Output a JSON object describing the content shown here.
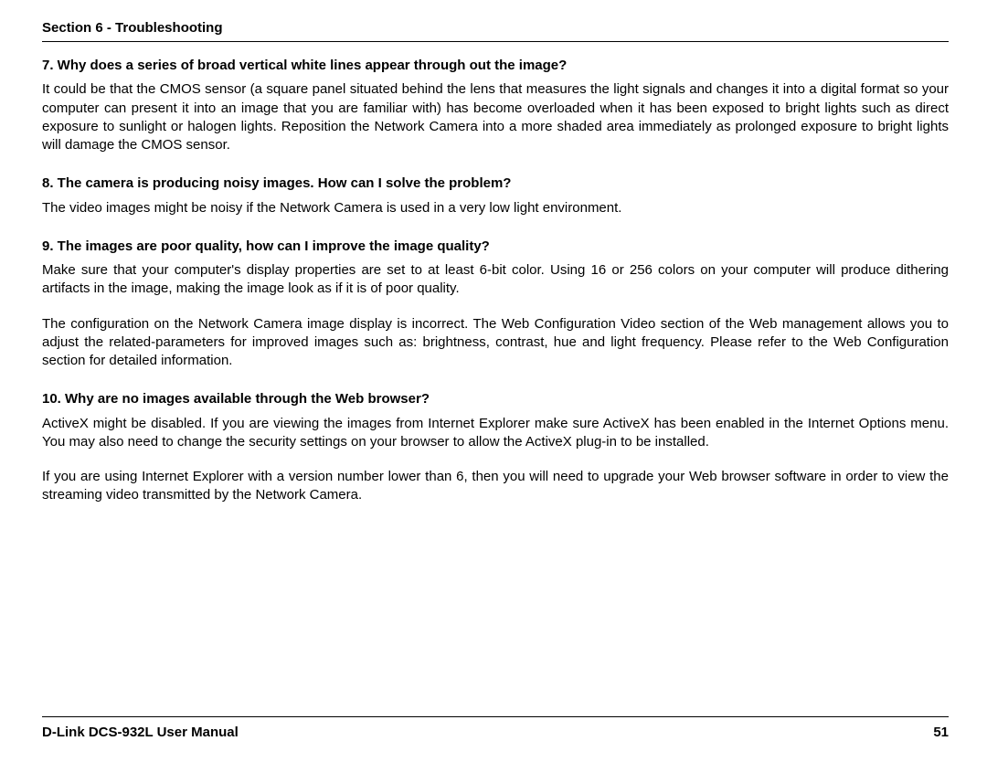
{
  "header": {
    "section": "Section 6 - Troubleshooting"
  },
  "qa": [
    {
      "q": "7. Why does a series of broad vertical white lines appear through out the image?",
      "a": [
        "It could be that the CMOS sensor (a square panel situated behind the lens that measures the light signals and changes it into a digital format so your computer can present it into an image that you are familiar with) has become overloaded when it has been exposed to bright lights such as direct exposure to sunlight or halogen lights. Reposition the Network Camera into a more shaded area immediately as prolonged exposure to bright lights will damage the CMOS sensor."
      ]
    },
    {
      "q": "8. The camera is producing noisy images. How can I solve the problem?",
      "a": [
        "The video images might be noisy if the Network Camera is used in a very low light environment."
      ]
    },
    {
      "q": "9. The images are poor quality, how can I improve the image quality?",
      "a": [
        "Make sure that your computer's display properties are set to at least 6-bit color. Using 16 or 256 colors on your computer will produce dithering artifacts in the image, making the image look as if it is of poor quality.",
        "The configuration on the Network Camera image display is incorrect. The Web Configuration Video section of the Web management allows you to adjust the related-parameters for improved images such as: brightness, contrast, hue and light frequency. Please refer to the Web Configuration section for detailed information."
      ]
    },
    {
      "q": "10. Why are no images available through the Web browser?",
      "a": [
        "ActiveX might be disabled. If you are viewing the images from Internet Explorer make sure ActiveX has been enabled in the Internet Options menu. You may also need to change the security settings on your browser to allow the ActiveX plug-in to be installed.",
        "If you are using Internet Explorer with a version number lower than 6, then you will need to upgrade your Web browser software in order to view the streaming video transmitted by the Network Camera."
      ]
    }
  ],
  "footer": {
    "manual": "D-Link DCS-932L User Manual",
    "page": "51"
  }
}
